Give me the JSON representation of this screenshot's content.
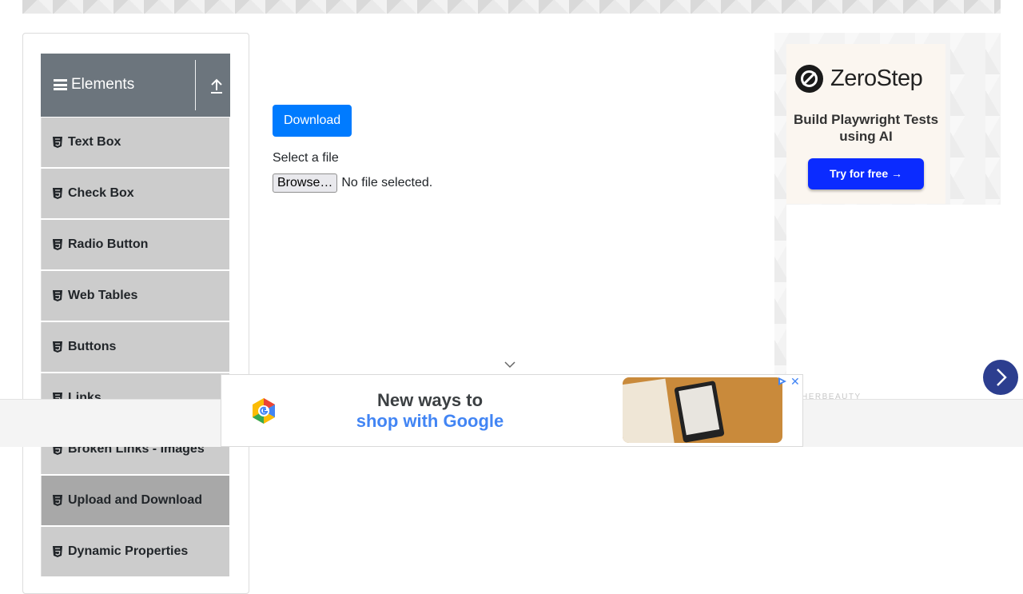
{
  "sidebar": {
    "group_title": "Elements",
    "items": [
      {
        "label": "Text Box"
      },
      {
        "label": "Check Box"
      },
      {
        "label": "Radio Button"
      },
      {
        "label": "Web Tables"
      },
      {
        "label": "Buttons"
      },
      {
        "label": "Links"
      },
      {
        "label": "Broken Links - Images"
      },
      {
        "label": "Upload and Download",
        "active": true
      },
      {
        "label": "Dynamic Properties"
      }
    ]
  },
  "main": {
    "download_label": "Download",
    "select_file_label": "Select a file",
    "browse_label": "Browse…",
    "no_file_text": "No file selected."
  },
  "right_ad": {
    "brand": "ZeroStep",
    "tagline": "Build Playwright Tests using AI",
    "cta": "Try for free →",
    "footer_label": "HERBEAUTY"
  },
  "bottom_ad": {
    "line1": "New ways to",
    "line2": "shop with Google",
    "close_glyph": "✕"
  },
  "colors": {
    "primary_button": "#007bff",
    "sidebar_header": "#6c757d",
    "menu_item": "#cccccc",
    "menu_item_active": "#a8a8a8",
    "next_button": "#2c3e8f"
  }
}
